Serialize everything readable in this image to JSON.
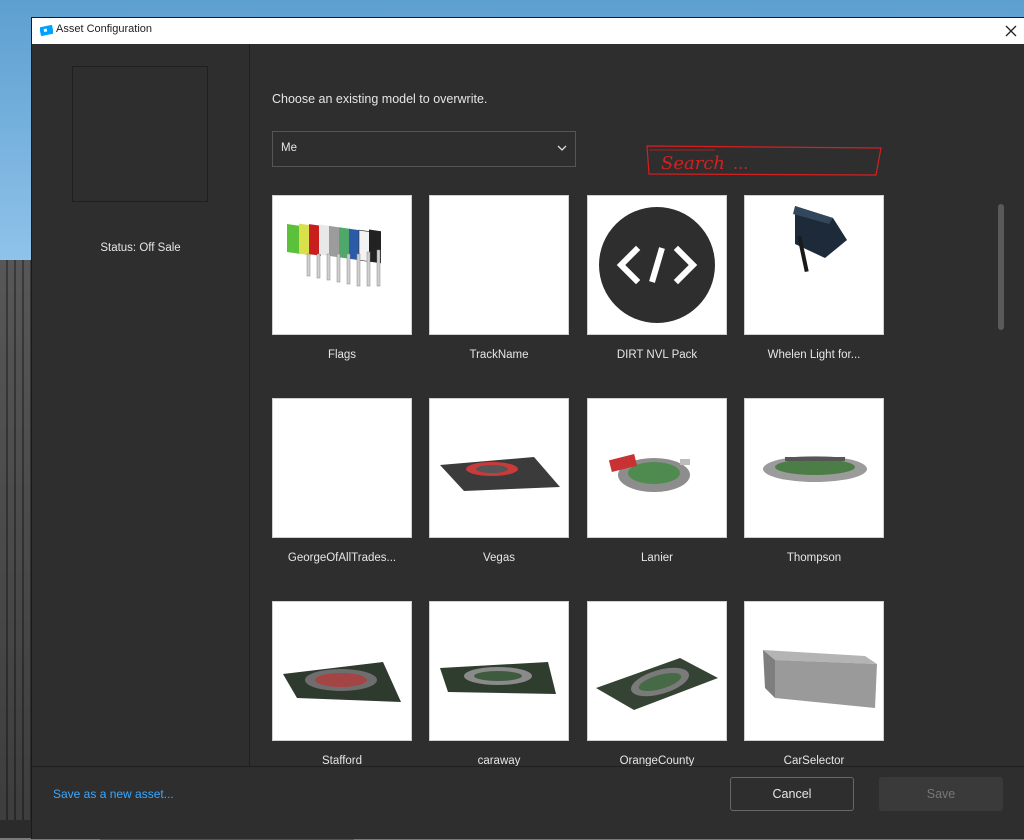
{
  "dialog": {
    "title": "Asset Configuration"
  },
  "left_panel": {
    "status": "Status: Off Sale"
  },
  "main": {
    "instruction": "Choose an existing model to overwrite.",
    "owner_dropdown": {
      "selected": "Me"
    },
    "search_annotation": "Search"
  },
  "assets": [
    {
      "name": "Flags",
      "thumb": "flags"
    },
    {
      "name": "TrackName",
      "thumb": "blank"
    },
    {
      "name": "DIRT NVL Pack",
      "thumb": "code-icon"
    },
    {
      "name": "Whelen Light for...",
      "thumb": "light-bar"
    },
    {
      "name": "GeorgeOfAllTrades...",
      "thumb": "blank"
    },
    {
      "name": "Vegas",
      "thumb": "track"
    },
    {
      "name": "Lanier",
      "thumb": "track"
    },
    {
      "name": "Thompson",
      "thumb": "track"
    },
    {
      "name": "Stafford",
      "thumb": "track"
    },
    {
      "name": "caraway",
      "thumb": "track"
    },
    {
      "name": "OrangeCounty",
      "thumb": "track"
    },
    {
      "name": "CarSelector",
      "thumb": "gray-block"
    }
  ],
  "footer": {
    "save_new": "Save as a new asset...",
    "cancel": "Cancel",
    "save": "Save"
  },
  "colors": {
    "dialog_bg": "#2e2e2e",
    "link": "#3aa8ff",
    "annotation": "#d61f1f",
    "app_icon": "#00a2ff"
  }
}
